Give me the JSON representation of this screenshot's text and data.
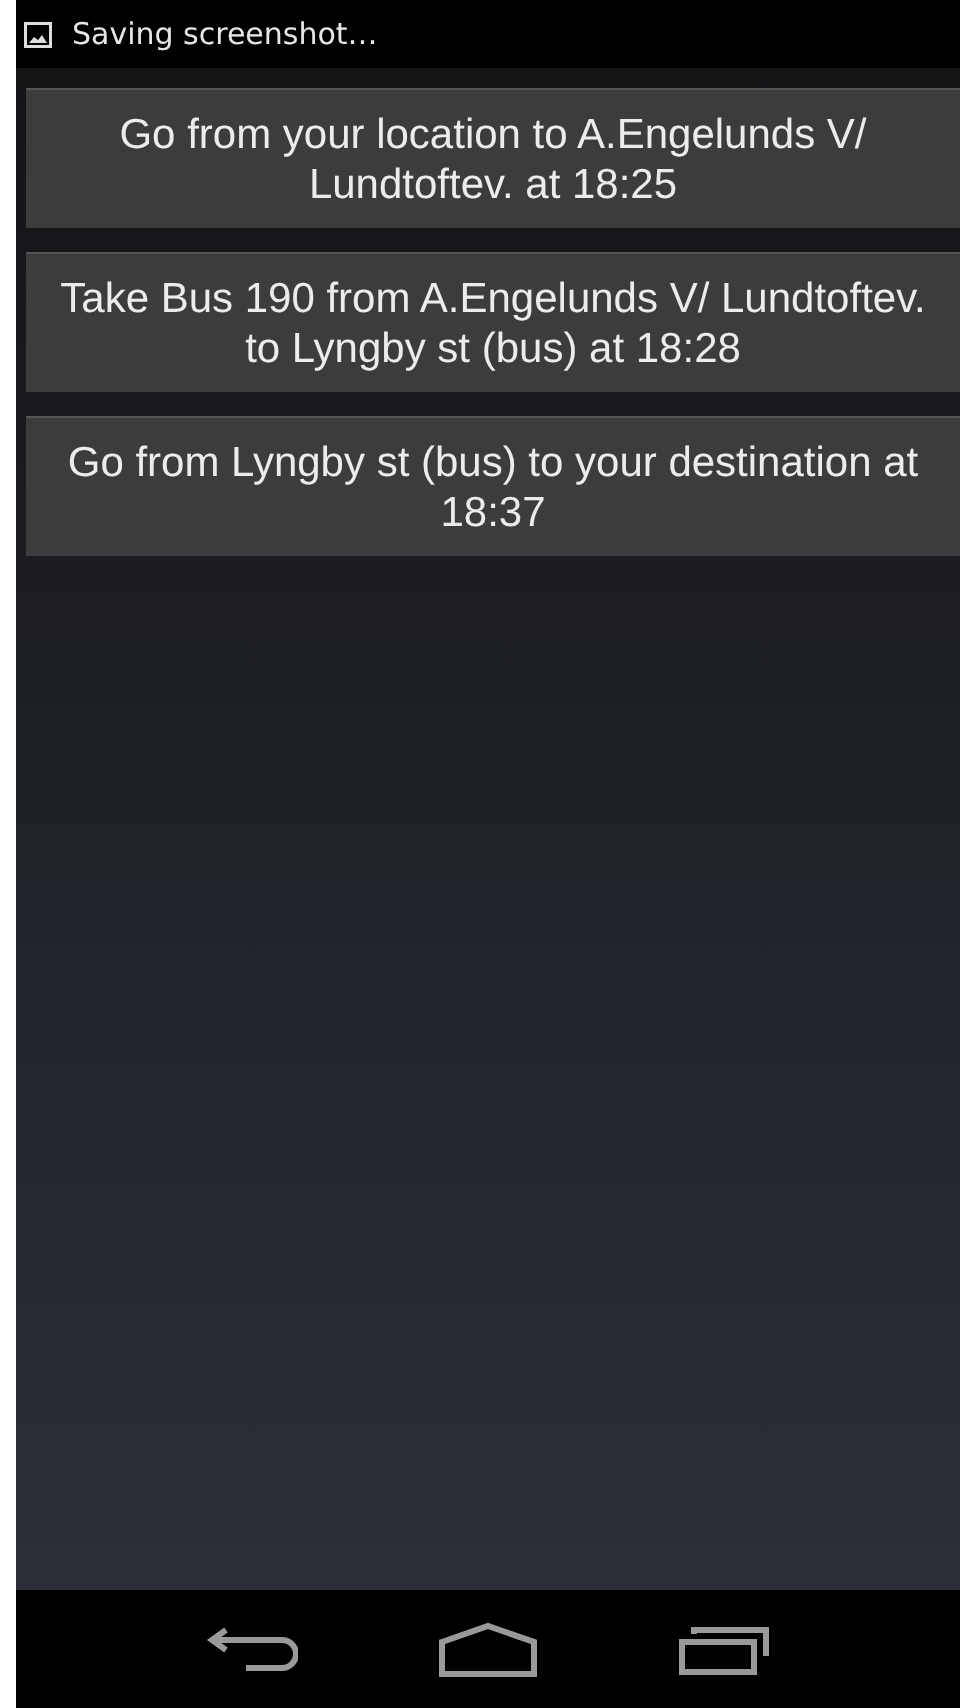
{
  "status_bar": {
    "notification": "Saving screenshot…"
  },
  "steps": [
    {
      "text": "Go from your location to A.Engelunds V/ Lundtoftev. at 18:25"
    },
    {
      "text": "Take Bus 190 from A.Engelunds V/ Lundtoftev. to Lyngby st (bus) at 18:28"
    },
    {
      "text": "Go from Lyngby st (bus) to your destination at 18:37"
    }
  ]
}
